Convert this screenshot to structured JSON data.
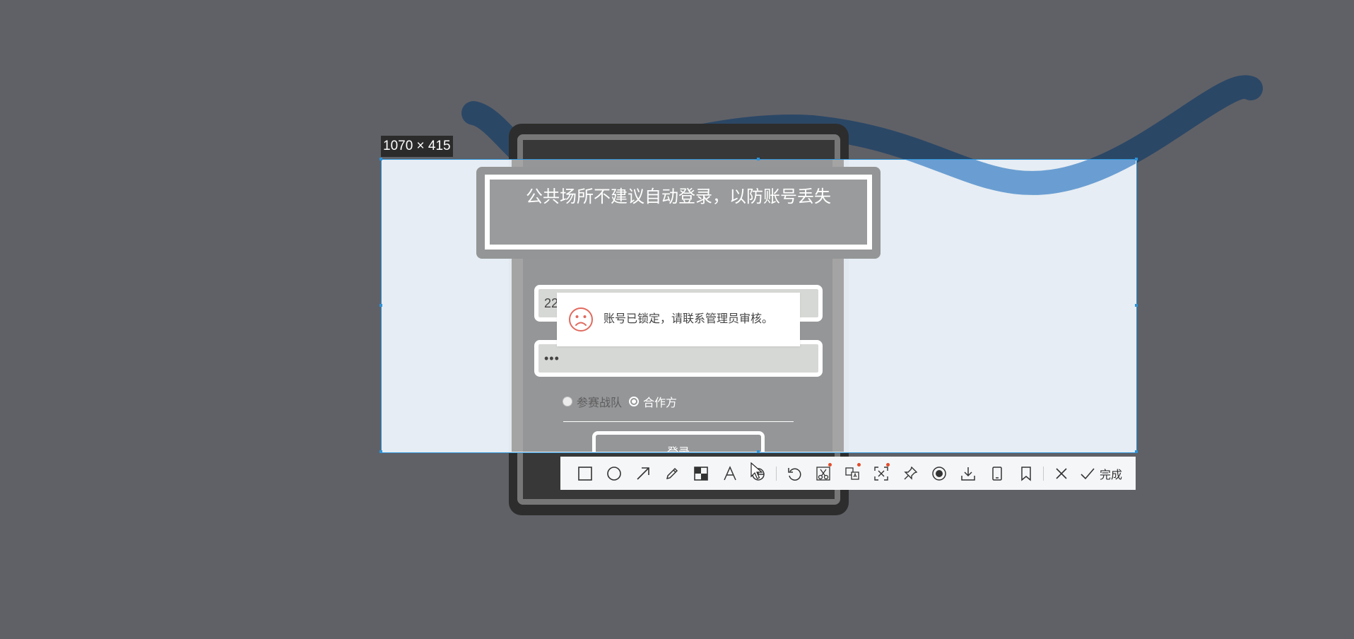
{
  "screenshot_tool": {
    "selection_size_label": "1070 × 415",
    "selection_color": "#2d93d9",
    "toolbar": {
      "tools": [
        {
          "name": "rectangle-tool-icon"
        },
        {
          "name": "ellipse-tool-icon"
        },
        {
          "name": "arrow-tool-icon"
        },
        {
          "name": "pencil-tool-icon"
        },
        {
          "name": "mosaic-tool-icon"
        },
        {
          "name": "text-tool-icon"
        },
        {
          "name": "ocr-highlight-tool-icon"
        },
        {
          "name": "undo-icon"
        },
        {
          "name": "scissors-tool-icon",
          "badge": true
        },
        {
          "name": "translate-tool-icon",
          "badge": true
        },
        {
          "name": "screen-recognize-tool-icon",
          "badge": true
        },
        {
          "name": "pin-icon"
        },
        {
          "name": "record-icon"
        },
        {
          "name": "download-icon"
        },
        {
          "name": "phone-icon"
        },
        {
          "name": "bookmark-icon"
        },
        {
          "name": "close-icon"
        }
      ],
      "done_label": "完成",
      "badge_color": "#e24c2a"
    }
  },
  "login_page": {
    "tip_banner": "公共场所不建议自动登录，以防账号丢失",
    "username_value": "22",
    "password_value": "•••",
    "radio_options": [
      {
        "label": "参赛战队",
        "checked": false
      },
      {
        "label": "合作方",
        "checked": true
      }
    ],
    "login_button_label": "登录"
  },
  "toast": {
    "message": "账号已锁定，请联系管理员审核。",
    "icon": "sad-face-icon",
    "icon_color": "#e06a5e"
  }
}
